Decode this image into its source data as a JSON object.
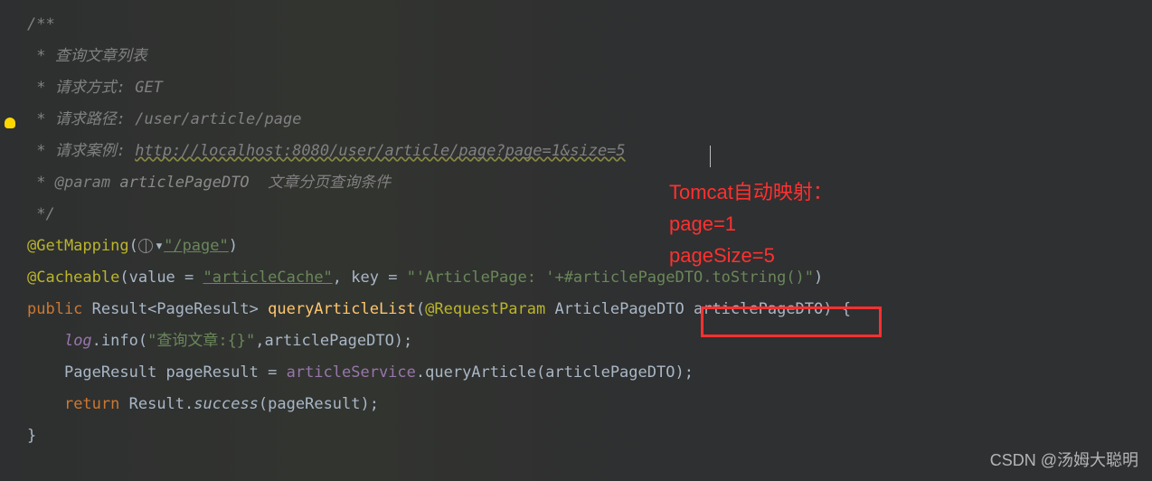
{
  "code": {
    "doc_start": "/**",
    "doc_line1_star": " * ",
    "doc_line1_text": "查询文章列表",
    "doc_line2_star": " * ",
    "doc_line2_label": "请求方式: ",
    "doc_line2_value": "GET",
    "doc_line3_star": " * ",
    "doc_line3_label": "请求路径: ",
    "doc_line3_value": "/user/article/page",
    "doc_line4_star": " * ",
    "doc_line4_label": "请求案例: ",
    "doc_line4_value": "http://localhost:8080/user/article/page?page=1&size=5",
    "doc_line5_star": " * ",
    "doc_line5_tag": "@param",
    "doc_line5_param": " articlePageDTO  ",
    "doc_line5_desc": "文章分页查询条件",
    "doc_end": " */",
    "annotation1": "@GetMapping",
    "annotation1_value": "\"/page\"",
    "annotation2": "@Cacheable",
    "annotation2_attr1": "value = ",
    "annotation2_val1": "\"articleCache\"",
    "annotation2_sep": ", key = ",
    "annotation2_val2a": "\"'ArticlePage: '",
    "annotation2_val2b": "+#articlePageDTO.toString()\"",
    "method_public": "public",
    "method_return": " Result<PageResult> ",
    "method_name": "queryArticleList",
    "method_param_anno": "@RequestParam",
    "method_param_type": " ArticlePageDTO ",
    "method_param_name": "articlePageDTO",
    "log_obj": "log",
    "log_method": ".info(",
    "log_string": "\"查询文章:{}\"",
    "log_arg": ",articlePageDTO);",
    "line_pageresult": "PageResult pageResult = ",
    "line_service": "articleService",
    "line_service_call": ".queryArticle(articlePageDTO);",
    "return_kw": "return",
    "return_call": " Result.",
    "return_method": "success",
    "return_arg": "(pageResult);",
    "close_brace": "}"
  },
  "annotation": {
    "line1": "Tomcat自动映射：",
    "line2": "page=1",
    "line3": "pageSize=5"
  },
  "watermark": "CSDN @汤姆大聪明"
}
